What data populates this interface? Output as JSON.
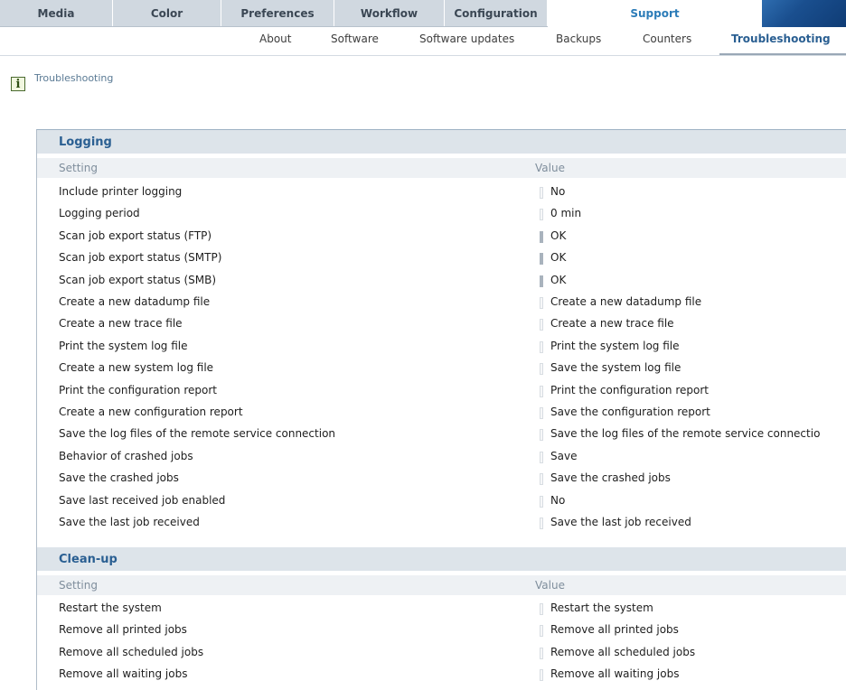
{
  "main_tabs": [
    "Media",
    "Color",
    "Preferences",
    "Workflow",
    "Configuration",
    "Support"
  ],
  "sub_tabs": [
    "About",
    "Software",
    "Software updates",
    "Backups",
    "Counters",
    "Troubleshooting"
  ],
  "breadcrumb": "Troubleshooting",
  "logging": {
    "title": "Logging",
    "col_setting": "Setting",
    "col_value": "Value",
    "rows": [
      {
        "setting": "Include printer logging",
        "value": "No"
      },
      {
        "setting": "Logging period",
        "value": "0 min"
      },
      {
        "setting": "Scan job export status (FTP)",
        "value": "OK"
      },
      {
        "setting": "Scan job export status (SMTP)",
        "value": "OK"
      },
      {
        "setting": "Scan job export status (SMB)",
        "value": "OK"
      },
      {
        "setting": "Create a new datadump file",
        "value": "Create a new datadump file"
      },
      {
        "setting": "Create a new trace file",
        "value": "Create a new trace file"
      },
      {
        "setting": "Print the system log file",
        "value": "Print the system log file"
      },
      {
        "setting": "Create a new system log file",
        "value": "Save the system log file"
      },
      {
        "setting": "Print the configuration report",
        "value": "Print the configuration report"
      },
      {
        "setting": "Create a new configuration report",
        "value": "Save the configuration report"
      },
      {
        "setting": "Save the log files of the remote service connection",
        "value": "Save the log files of the remote service connectio"
      },
      {
        "setting": "Behavior of crashed jobs",
        "value": "Save"
      },
      {
        "setting": "Save the crashed jobs",
        "value": "Save the crashed jobs"
      },
      {
        "setting": "Save last received job enabled",
        "value": "No"
      },
      {
        "setting": "Save the last job received",
        "value": "Save the last job received"
      }
    ]
  },
  "cleanup": {
    "title": "Clean-up",
    "col_setting": "Setting",
    "col_value": "Value",
    "rows": [
      {
        "setting": "Restart the system",
        "value": "Restart the system"
      },
      {
        "setting": "Remove all printed jobs",
        "value": "Remove all printed jobs"
      },
      {
        "setting": "Remove all scheduled jobs",
        "value": "Remove all scheduled jobs"
      },
      {
        "setting": "Remove all waiting jobs",
        "value": "Remove all waiting jobs"
      }
    ]
  },
  "colors": {
    "tab_bg": "#d0d8e0",
    "accent": "#2a5f92",
    "section_bg": "#dde4ea"
  }
}
